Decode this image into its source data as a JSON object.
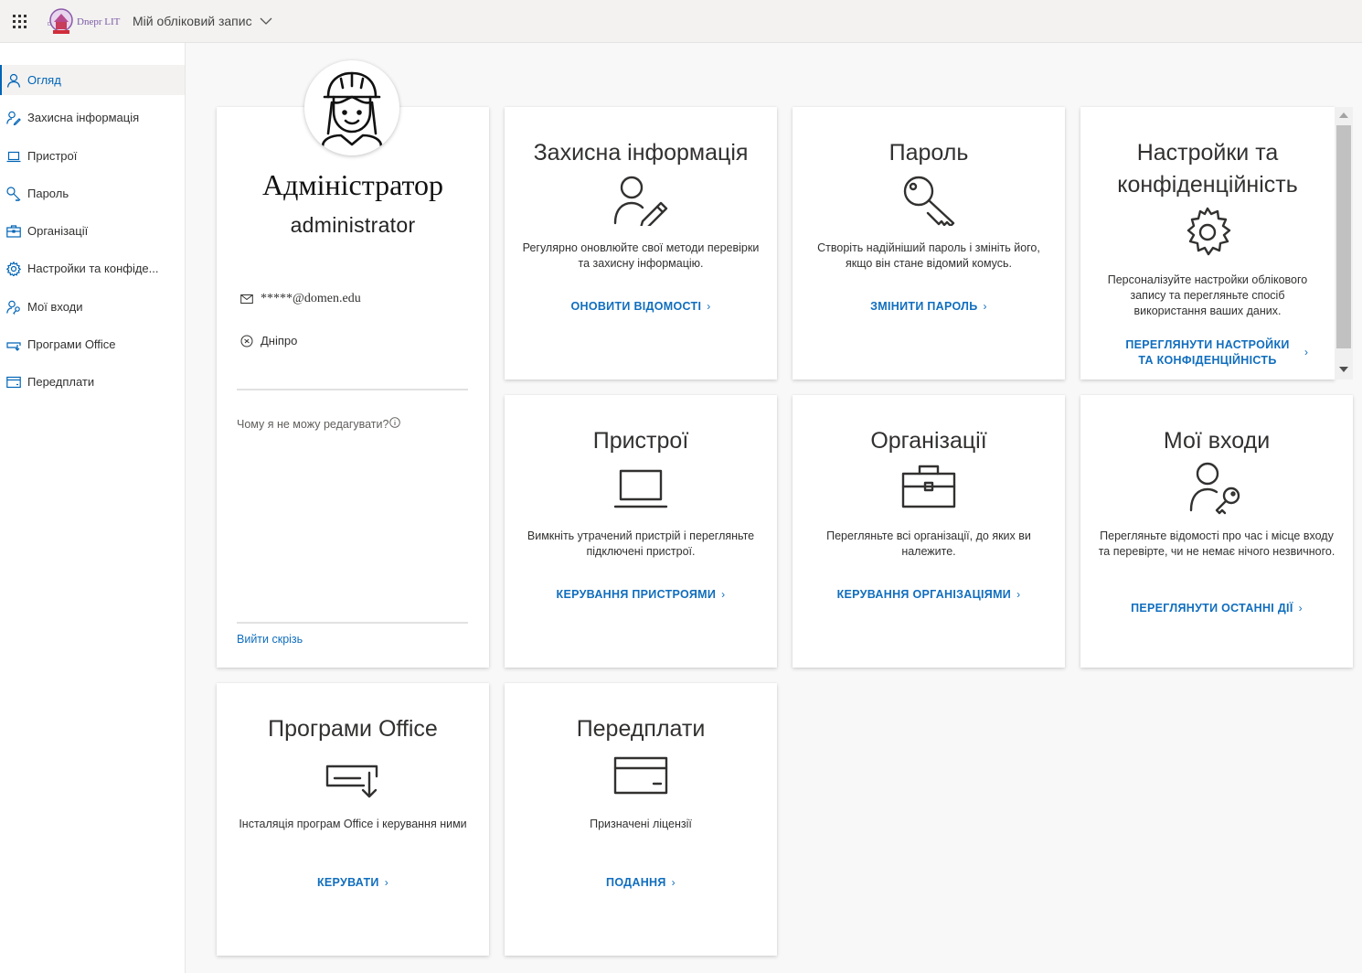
{
  "header": {
    "logo_text": "Dnepr LIT",
    "account_menu_label": "Мій обліковий запис"
  },
  "sidebar": {
    "items": [
      {
        "label": "Огляд",
        "icon": "person-icon",
        "active": true
      },
      {
        "label": "Захисна інформація",
        "icon": "person-key-icon"
      },
      {
        "label": "Пристрої",
        "icon": "laptop-icon"
      },
      {
        "label": "Пароль",
        "icon": "key-icon"
      },
      {
        "label": "Організації",
        "icon": "briefcase-icon"
      },
      {
        "label": "Настройки та конфіде...",
        "icon": "gear-icon"
      },
      {
        "label": "Мої входи",
        "icon": "person-key-icon"
      },
      {
        "label": "Програми Office",
        "icon": "office-install-icon"
      },
      {
        "label": "Передплати",
        "icon": "card-icon"
      }
    ]
  },
  "profile": {
    "display_name": "Адміністратор",
    "username": "administrator",
    "email": "*****@domen.edu",
    "location": "Дніпро",
    "why_cant_edit": "Чому я не можу редагувати?",
    "sign_out_everywhere": "Вийти скрізь"
  },
  "cards": {
    "security_info": {
      "title": "Захисна інформація",
      "description": "Регулярно оновлюйте свої методи перевірки та захисну інформацію.",
      "link": "ОНОВИТИ ВІДОМОСТІ"
    },
    "password": {
      "title": "Пароль",
      "description": "Створіть надійніший пароль і змініть його, якщо він стане відомий комусь.",
      "link": "ЗМІНИТИ ПАРОЛЬ"
    },
    "settings_privacy": {
      "title": "Настройки та конфіденційність",
      "description": "Персоналізуйте настройки облікового запису та перегляньте спосіб використання ваших даних.",
      "link": "ПЕРЕГЛЯНУТИ НАСТРОЙКИ ТА КОНФІДЕНЦІЙНІСТЬ"
    },
    "devices": {
      "title": "Пристрої",
      "description": "Вимкніть утрачений пристрій і перегляньте підключені пристрої.",
      "link": "КЕРУВАННЯ ПРИСТРОЯМИ"
    },
    "organizations": {
      "title": "Організації",
      "description": "Перегляньте всі організації, до яких ви належите.",
      "link": "КЕРУВАННЯ ОРГАНІЗАЦІЯМИ"
    },
    "my_signins": {
      "title": "Мої входи",
      "description": "Перегляньте відомості про час і місце входу та перевірте, чи не немає нічого незвичного.",
      "link": "ПЕРЕГЛЯНУТИ ОСТАННІ ДІЇ"
    },
    "office_apps": {
      "title": "Програми Office",
      "description": "Інсталяція програм Office і керування ними",
      "link": "КЕРУВАТИ"
    },
    "subscriptions": {
      "title": "Передплати",
      "description": "Призначені ліцензії",
      "link": "ПОДАННЯ"
    }
  },
  "colors": {
    "accent": "#0064b6",
    "link": "#106ebe",
    "text": "#323130",
    "background": "#f8f8f8"
  }
}
